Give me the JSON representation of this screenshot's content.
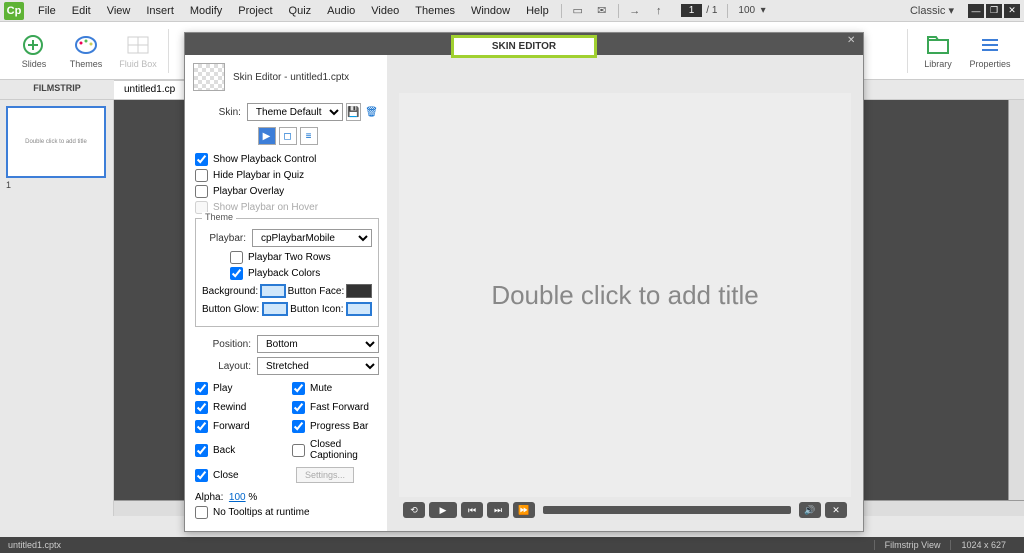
{
  "menubar": {
    "logo": "Cp",
    "items": [
      "File",
      "Edit",
      "View",
      "Insert",
      "Modify",
      "Project",
      "Quiz",
      "Audio",
      "Video",
      "Themes",
      "Window",
      "Help"
    ],
    "page_current": "1",
    "page_sep": "/",
    "page_total": "1",
    "zoom": "100",
    "workspace": "Classic"
  },
  "ribbon": {
    "left": [
      {
        "label": "Slides",
        "name": "slides-button"
      },
      {
        "label": "Themes",
        "name": "themes-button"
      },
      {
        "label": "Fluid Box",
        "name": "fluidbox-button"
      }
    ],
    "right": [
      {
        "label": "Library",
        "name": "library-button"
      },
      {
        "label": "Properties",
        "name": "properties-button"
      }
    ]
  },
  "tabs": {
    "filmstrip": "FILMSTRIP",
    "doc": "untitled1.cp"
  },
  "filmstrip": {
    "thumb_text": "Double click to add title",
    "num": "1"
  },
  "skin": {
    "title": "SKIN EDITOR",
    "header": "Skin Editor - untitled1.cptx",
    "skin_label": "Skin:",
    "skin_value": "Theme Default",
    "show_playback": "Show Playback Control",
    "hide_playbar_quiz": "Hide Playbar in Quiz",
    "playbar_overlay": "Playbar Overlay",
    "show_on_hover": "Show Playbar on Hover",
    "theme_legend": "Theme",
    "playbar_label": "Playbar:",
    "playbar_value": "cpPlaybarMobile",
    "two_rows": "Playbar Two Rows",
    "playback_colors": "Playback Colors",
    "background": "Background:",
    "button_face": "Button Face:",
    "button_glow": "Button Glow:",
    "button_icon": "Button Icon:",
    "position_label": "Position:",
    "position_value": "Bottom",
    "layout_label": "Layout:",
    "layout_value": "Stretched",
    "opts": {
      "play": "Play",
      "mute": "Mute",
      "rewind": "Rewind",
      "ff": "Fast Forward",
      "forward": "Forward",
      "progress": "Progress Bar",
      "back": "Back",
      "cc": "Closed Captioning",
      "close": "Close",
      "settings": "Settings..."
    },
    "alpha_label": "Alpha:",
    "alpha_value": "100",
    "alpha_pct": "%",
    "no_tooltips": "No Tooltips at runtime"
  },
  "preview": {
    "placeholder": "Double click to add title"
  },
  "statusbar": {
    "file": "untitled1.cptx",
    "view": "Filmstrip View",
    "dims": "1024 x 627"
  }
}
